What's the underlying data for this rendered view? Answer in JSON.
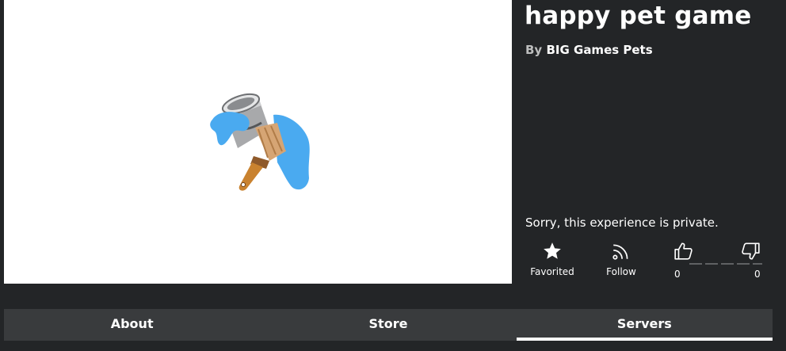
{
  "game": {
    "title": "happy pet game",
    "by_label": "By",
    "creator": "BIG Games Pets",
    "private_message": "Sorry, this experience is private."
  },
  "actions": {
    "favorite_label": "Favorited",
    "follow_label": "Follow",
    "upvotes": "0",
    "downvotes": "0"
  },
  "tabs": [
    {
      "label": "About",
      "active": false
    },
    {
      "label": "Store",
      "active": false
    },
    {
      "label": "Servers",
      "active": true
    }
  ],
  "thumbnail": {
    "icon": "paint-bucket-brush-icon"
  },
  "colors": {
    "background": "#232527",
    "tab_bar": "#393b3d",
    "paint_blue": "#4aaaf0"
  }
}
